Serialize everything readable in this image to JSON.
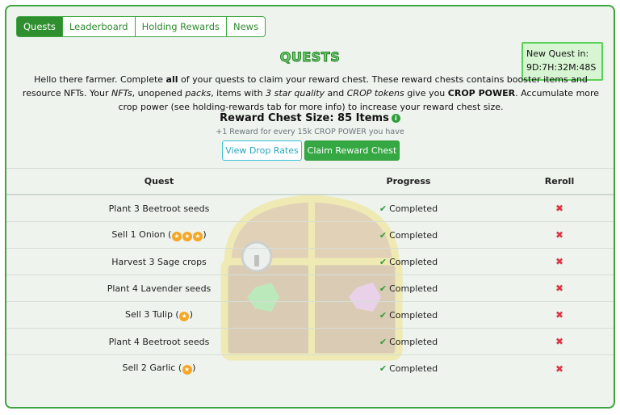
{
  "tabs": [
    {
      "label": "Quests",
      "active": true
    },
    {
      "label": "Leaderboard",
      "active": false
    },
    {
      "label": "Holding Rewards",
      "active": false
    },
    {
      "label": "News",
      "active": false
    }
  ],
  "new_quest": {
    "label": "New Quest in:",
    "countdown": "9D:7H:32M:48S"
  },
  "title": "QUESTS",
  "intro": {
    "t1": "Hello there farmer. Complete ",
    "t1_bold": "all",
    "t2": " of your quests to claim your reward chest. These reward chests contains booster items and resource NFTs. Your ",
    "nfts": "NFTs",
    "t3": ", unopened ",
    "packs": "packs",
    "t4": ", items with ",
    "star_quality": "3 star quality",
    "t5": " and ",
    "crop_tokens": "CROP tokens",
    "t6": " give you ",
    "crop_power": "CROP POWER",
    "t7": ". Accumulate more crop power (see holding-rewards tab for more info) to increase your reward chest size."
  },
  "reward": {
    "size_text": "Reward Chest Size: 85 Items",
    "info_icon": "i",
    "note": "+1 Reward for every 15k CROP POWER you have"
  },
  "buttons": {
    "drop_rates": "View Drop Rates",
    "claim": "Claim Reward Chest"
  },
  "table": {
    "headers": {
      "quest": "Quest",
      "progress": "Progress",
      "reroll": "Reroll"
    },
    "rows": [
      {
        "q1": "Plant 3 Beetroot seeds",
        "stars": 0,
        "q2": "",
        "progress": "Completed",
        "reroll": "✖"
      },
      {
        "q1": "Sell 1 Onion (",
        "stars": 3,
        "q2": ")",
        "progress": "Completed",
        "reroll": "✖"
      },
      {
        "q1": "Harvest 3 Sage crops",
        "stars": 0,
        "q2": "",
        "progress": "Completed",
        "reroll": "✖"
      },
      {
        "q1": "Plant 4 Lavender seeds",
        "stars": 0,
        "q2": "",
        "progress": "Completed",
        "reroll": "✖"
      },
      {
        "q1": "Sell 3 Tulip (",
        "stars": 1,
        "q2": ")",
        "progress": "Completed",
        "reroll": "✖"
      },
      {
        "q1": "Plant 4 Beetroot seeds",
        "stars": 0,
        "q2": "",
        "progress": "Completed",
        "reroll": "✖"
      },
      {
        "q1": "Sell 2 Garlic (",
        "stars": 1,
        "q2": ")",
        "progress": "Completed",
        "reroll": "✖"
      }
    ]
  },
  "icons": {
    "check": "check-icon",
    "star": "star-icon",
    "reroll": "close-icon",
    "chest": "treasure-chest-watermark"
  },
  "colors": {
    "accent": "#2f8f2f",
    "info": "#25a7bd",
    "danger": "#dc3545",
    "star": "#f6a623"
  }
}
